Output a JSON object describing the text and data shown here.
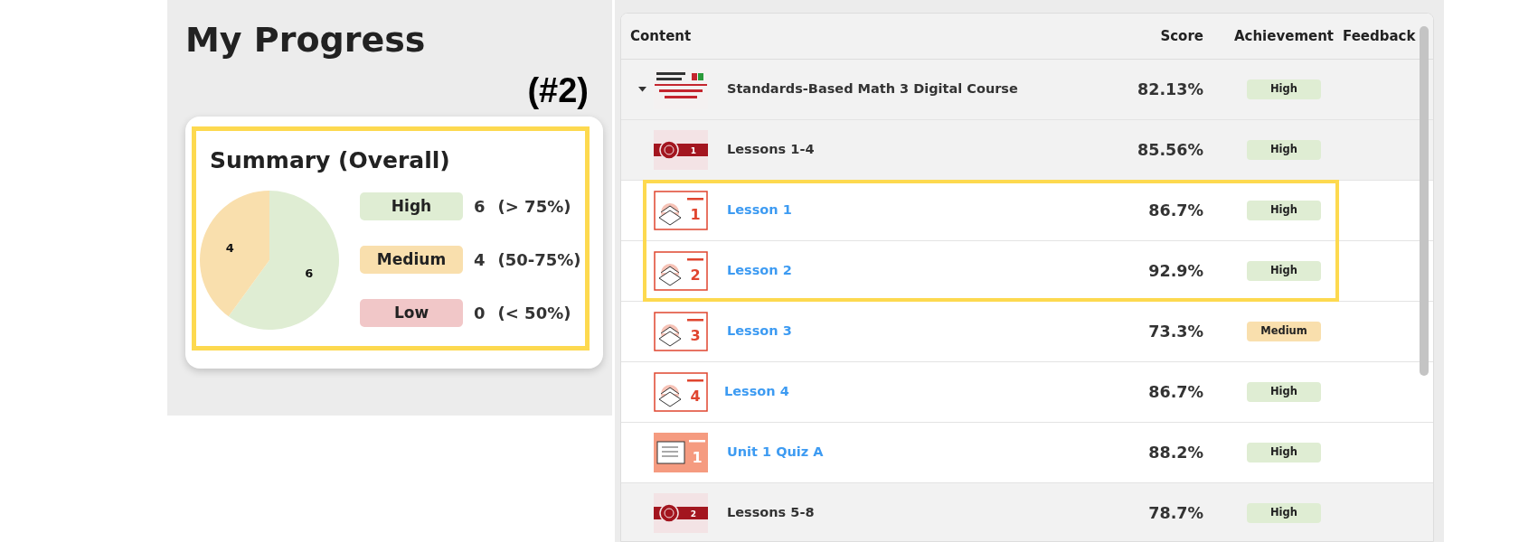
{
  "page": {
    "title": "My Progress",
    "annotation": "(#2)"
  },
  "summary": {
    "highlighted": true,
    "chart_data": {
      "type": "pie",
      "title": "Summary (Overall)",
      "categories": [
        "High",
        "Medium",
        "Low"
      ],
      "values": [
        6,
        4,
        0
      ],
      "data_labels": true
    },
    "legend": [
      {
        "count": "6",
        "range": "(> 75%)",
        "color": "#dfedd3"
      },
      {
        "count": "4",
        "range": "(50-75%)",
        "color": "#f9dfad"
      },
      {
        "count": "0",
        "range": "(< 50%)",
        "color": "#f1c7c8"
      }
    ]
  },
  "table": {
    "columns": [
      "Content",
      "Score",
      "Achievement",
      "Feedback"
    ],
    "rows": [
      {
        "kind": "course",
        "expanded": true,
        "title": "Standards-Based Math 3 Digital Course",
        "score": "82.13%",
        "achievement": "High",
        "color": "#dfedd3",
        "highlighted": false
      },
      {
        "kind": "unit",
        "thumb": {
          "number": "1"
        },
        "title": "Lessons 1-4",
        "score": "85.56%",
        "achievement": "High",
        "color": "#dfedd3",
        "highlighted": false
      },
      {
        "kind": "lesson",
        "thumb": {
          "number": "1"
        },
        "title": "Lesson 1",
        "score": "86.7%",
        "achievement": "High",
        "color": "#dfedd3",
        "highlighted": true
      },
      {
        "kind": "lesson",
        "thumb": {
          "number": "2"
        },
        "title": "Lesson 2",
        "score": "92.9%",
        "achievement": "High",
        "color": "#dfedd3",
        "highlighted": true
      },
      {
        "kind": "lesson",
        "thumb": {
          "number": "3"
        },
        "title": "Lesson 3",
        "score": "73.3%",
        "achievement": "Medium",
        "color": "#f9dfad",
        "highlighted": false
      },
      {
        "kind": "lesson",
        "thumb": {
          "number": "4"
        },
        "title": "Lesson 4",
        "score": "86.7%",
        "achievement": "High",
        "color": "#dfedd3",
        "highlighted": false
      },
      {
        "kind": "quiz",
        "thumb": {
          "number": "1"
        },
        "title": "Unit 1 Quiz A",
        "score": "88.2%",
        "achievement": "High",
        "color": "#dfedd3",
        "highlighted": false
      },
      {
        "kind": "unit",
        "thumb": {
          "number": "2"
        },
        "title": "Lessons 5-8",
        "score": "78.7%",
        "achievement": "High",
        "color": "#dfedd3",
        "highlighted": false
      }
    ]
  }
}
